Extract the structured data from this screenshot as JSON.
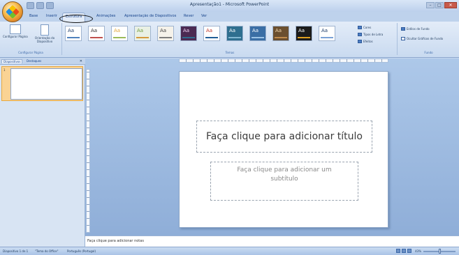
{
  "window": {
    "title": "Apresentação1 - Microsoft PowerPoint",
    "controls": [
      "–",
      "□",
      "✕"
    ]
  },
  "tabs": [
    {
      "label": "Base"
    },
    {
      "label": "Inserir"
    },
    {
      "label": "Estrutura"
    },
    {
      "label": "Animações"
    },
    {
      "label": "Apresentação de Diapositivos"
    },
    {
      "label": "Rever"
    },
    {
      "label": "Ver"
    }
  ],
  "ribbon": {
    "page_setup": {
      "config_page_label": "Configurar Página",
      "orientation_label": "Orientação do Diapositivo",
      "group_label": "Configurar Página"
    },
    "themes": {
      "group_label": "Temas",
      "items": [
        {
          "label": "Aa",
          "bg": "#ffffff",
          "fg": "#1f3d6b",
          "bar": "#4f81bd"
        },
        {
          "label": "Aa",
          "bg": "#ffffff",
          "fg": "#333333",
          "bar": "#c0504d"
        },
        {
          "label": "Aa",
          "bg": "#ffffff",
          "fg": "#e1a537",
          "bar": "#9bbb59"
        },
        {
          "label": "Aa",
          "bg": "#e9f0e4",
          "fg": "#6f9b3c",
          "bar": "#d59a3c"
        },
        {
          "label": "Aa",
          "bg": "#f5f2ea",
          "fg": "#444444",
          "bar": "#7d7d7d"
        },
        {
          "label": "Aa",
          "bg": "#4b2a52",
          "fg": "#f0d3f4",
          "bar": "#2e6b8d"
        },
        {
          "label": "Aa",
          "bg": "#ffffff",
          "fg": "#c0392b",
          "bar": "#1f5e96"
        },
        {
          "label": "Aa",
          "bg": "#2f6f8f",
          "fg": "#ffffff",
          "bar": "#82b8d2"
        },
        {
          "label": "Aa",
          "bg": "#3a6ea5",
          "fg": "#ffffff",
          "bar": "#9cc3e6"
        },
        {
          "label": "Aa",
          "bg": "#6b4f2f",
          "fg": "#f4d9b0",
          "bar": "#c08b4d"
        },
        {
          "label": "Aa",
          "bg": "#1b1b1b",
          "fg": "#ffffff",
          "bar": "#e0a020"
        },
        {
          "label": "Aa",
          "bg": "#ffffff",
          "fg": "#1f3d6b",
          "bar": "#7aa1d6"
        }
      ],
      "side_items": [
        "Cores",
        "Tipos de Letra",
        "Efeitos"
      ]
    },
    "background": {
      "group_label": "Fundo",
      "styles_label": "Estilos de Fundo",
      "hide_graphics_label": "Ocultar Gráficos de Fundo"
    }
  },
  "pane": {
    "tab_slides": "Diapositivos",
    "tab_outline": "Destaques",
    "close_glyph": "✕",
    "slide_number": "1"
  },
  "slide": {
    "title_placeholder": "Faça clique para adicionar título",
    "subtitle_placeholder": "Faça clique para adicionar um subtítulo"
  },
  "notes": {
    "placeholder": "Faça clique para adicionar notas"
  },
  "status": {
    "slide_info": "Diapositivo 1 de 1",
    "theme_info": "\"Tema do Office\"",
    "language": "Português (Portugal)",
    "zoom": "43%"
  }
}
